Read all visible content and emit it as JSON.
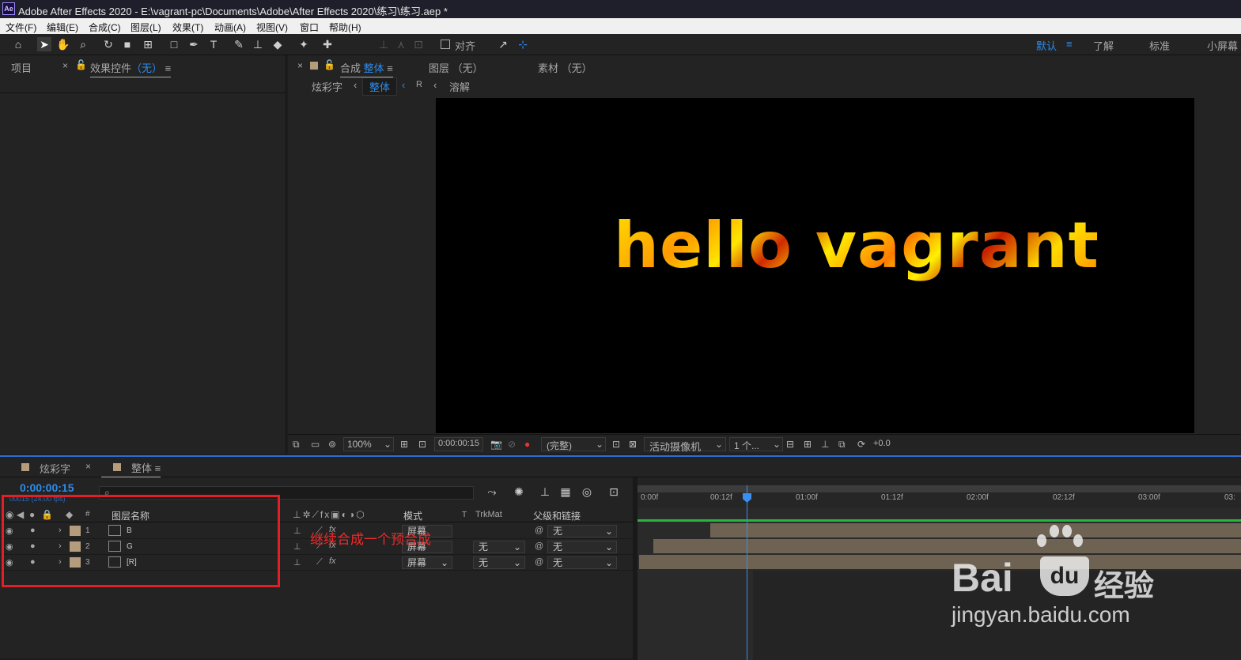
{
  "window": {
    "app_icon": "Ae",
    "title": "Adobe After Effects 2020 - E:\\vagrant-pc\\Documents\\Adobe\\After Effects 2020\\练习\\练习.aep *"
  },
  "menu": [
    "文件(F)",
    "编辑(E)",
    "合成(C)",
    "图层(L)",
    "效果(T)",
    "动画(A)",
    "视图(V)",
    "窗口",
    "帮助(H)"
  ],
  "toolbar": {
    "align_label": "对齐",
    "workspaces": [
      "默认",
      "了解",
      "标准",
      "小屏幕"
    ],
    "active_workspace": "默认"
  },
  "left_panel": {
    "tab_project": "项目",
    "tab_effect": "效果控件",
    "tab_effect_value": "（无）"
  },
  "viewer": {
    "tab_comp_prefix": "合成",
    "tab_comp_name": "整体",
    "tab_layer": "图层 （无）",
    "tab_footage": "素材 （无）",
    "breadcrumb": [
      "炫彩字",
      "整体",
      "R",
      "溶解"
    ],
    "canvas_text": "hello vagrant",
    "zoom": "100%",
    "timecode": "0:00:00:15",
    "resolution": "(完整)",
    "camera": "活动摄像机",
    "views": "1 个...",
    "exposure": "+0.0"
  },
  "timeline": {
    "tabs": [
      "炫彩字",
      "整体"
    ],
    "current_time": "0:00:00:15",
    "frame_info": "00015 (24.00 fps)",
    "search_placeholder": "",
    "headers": {
      "num": "#",
      "layer_name": "图层名称",
      "mode": "模式",
      "t": "T",
      "trkmat": "TrkMat",
      "parent": "父级和链接"
    },
    "layers": [
      {
        "num": "1",
        "name": "B",
        "mode": "屏幕",
        "trkmat": "",
        "parent": "无"
      },
      {
        "num": "2",
        "name": "G",
        "mode": "屏幕",
        "trkmat": "无",
        "parent": "无"
      },
      {
        "num": "3",
        "name": "[R]",
        "mode": "屏幕",
        "trkmat": "无",
        "parent": "无"
      }
    ],
    "ruler": [
      "0:00f",
      "00:12f",
      "01:00f",
      "01:12f",
      "02:00f",
      "02:12f",
      "03:00f",
      "03:"
    ],
    "playhead_seconds": 0.625
  },
  "annotation": "继续合成一个预合成",
  "watermark": {
    "brand": "Bai",
    "brand2": "经验",
    "url": "jingyan.baidu.com"
  },
  "colors": {
    "accent": "#2d8ceb",
    "highlight": "#e21f26",
    "label_tan": "#b39d7d"
  }
}
